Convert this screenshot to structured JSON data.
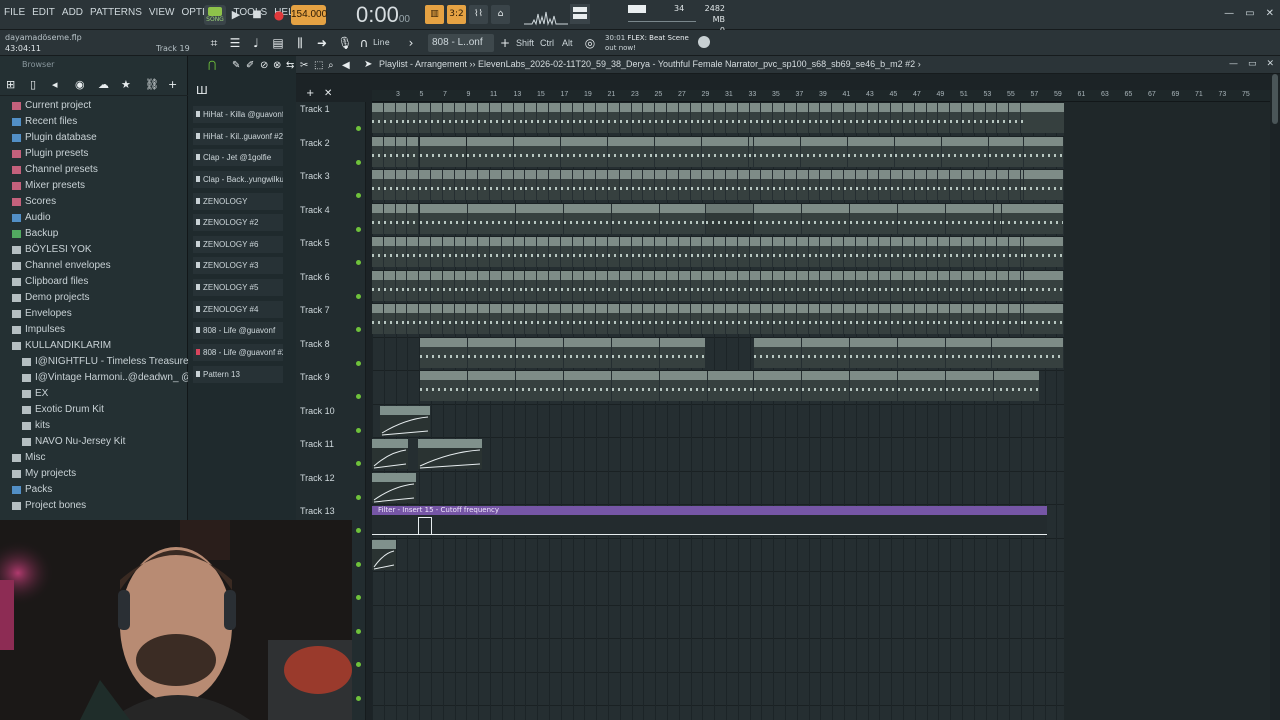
{
  "menu": [
    "FILE",
    "EDIT",
    "ADD",
    "PATTERNS",
    "VIEW",
    "OPTIONS",
    "TOOLS",
    "HELP"
  ],
  "transport": {
    "song_label": "SONG",
    "tempo": "154.000",
    "time": "0:00",
    "time_sub": "00"
  },
  "status": {
    "volume": "34",
    "memory": "2482 MB",
    "cpu": "0"
  },
  "info": {
    "project_name": "dayamadöseme.flp",
    "project_time": "43:04:11",
    "hint_track": "Track 19",
    "snap": "Line",
    "pattern": "808 - L..onf #2",
    "key_shift": "Shift",
    "key_ctrl": "Ctrl",
    "key_alt": "Alt",
    "news_time": "30:01",
    "news_title": "FLEX: Beat Scene",
    "news_sub": "out now!"
  },
  "browser": {
    "title": "Browser",
    "items": [
      {
        "label": "Current project",
        "color": "#e06a8a"
      },
      {
        "label": "Recent files",
        "color": "#5aa0e0"
      },
      {
        "label": "Plugin database",
        "color": "#5aa0e0"
      },
      {
        "label": "Plugin presets",
        "color": "#e06a8a"
      },
      {
        "label": "Channel presets",
        "color": "#e06a8a"
      },
      {
        "label": "Mixer presets",
        "color": "#e06a8a"
      },
      {
        "label": "Scores",
        "color": "#e06a8a"
      },
      {
        "label": "Audio",
        "color": "#5aa0e0"
      },
      {
        "label": "Backup",
        "color": "#5ac06a"
      },
      {
        "label": "BÖYLESI YOK",
        "color": "#cfd8dc"
      },
      {
        "label": "Channel envelopes",
        "color": "#cfd8dc"
      },
      {
        "label": "Clipboard files",
        "color": "#cfd8dc"
      },
      {
        "label": "Demo projects",
        "color": "#cfd8dc"
      },
      {
        "label": "Envelopes",
        "color": "#cfd8dc"
      },
      {
        "label": "Impulses",
        "color": "#cfd8dc"
      },
      {
        "label": "KULLANDIKLARIM",
        "color": "#cfd8dc"
      },
      {
        "label": "I@NIGHTFLU - Timeless Treasures",
        "color": "#cfd8dc",
        "indent": 1
      },
      {
        "label": "I@Vintage Harmoni..@deadwn_ @1mvnti",
        "color": "#cfd8dc",
        "indent": 1
      },
      {
        "label": "EX",
        "color": "#cfd8dc",
        "indent": 1
      },
      {
        "label": "Exotic Drum Kit",
        "color": "#cfd8dc",
        "indent": 1
      },
      {
        "label": "kits",
        "color": "#cfd8dc",
        "indent": 1
      },
      {
        "label": "NAVO Nu-Jersey Kit",
        "color": "#cfd8dc",
        "indent": 1
      },
      {
        "label": "Misc",
        "color": "#cfd8dc"
      },
      {
        "label": "My projects",
        "color": "#cfd8dc"
      },
      {
        "label": "Packs",
        "color": "#5aa0e0"
      },
      {
        "label": "Project bones",
        "color": "#cfd8dc"
      }
    ]
  },
  "channels": [
    "HiHat - Killa @guavonf",
    "HiHat - Kil..guavonf #2",
    "Clap - Jet @1golfie",
    "Clap - Back..yungwilku",
    "ZENOLOGY",
    "ZENOLOGY #2",
    "ZENOLOGY #6",
    "ZENOLOGY #3",
    "ZENOLOGY #5",
    "ZENOLOGY #4",
    "808 - Life @guavonf",
    "808 - Life @guavonf #2",
    "Pattern 13"
  ],
  "playlist": {
    "title": "Playlist - Arrangement",
    "file": "ElevenLabs_2026-02-11T20_59_38_Derya - Youthful Female Narrator_pvc_sp100_s68_sb69_se46_b_m2 #2",
    "ruler": [
      "3",
      "5",
      "7",
      "9",
      "11",
      "13",
      "15",
      "17",
      "19",
      "21",
      "23",
      "25",
      "27",
      "29",
      "31",
      "33",
      "35",
      "37",
      "39",
      "41",
      "43",
      "45",
      "47",
      "49",
      "51",
      "53",
      "55",
      "57",
      "59",
      "61",
      "63",
      "65",
      "67",
      "69",
      "71",
      "73",
      "75"
    ],
    "tracks": [
      "Track 1",
      "Track 2",
      "Track 3",
      "Track 4",
      "Track 5",
      "Track 6",
      "Track 7",
      "Track 8",
      "Track 9",
      "Track 10",
      "Track 11",
      "Track 12",
      "Track 13"
    ],
    "clip_labels": {
      "t1": "ZENOLOGY",
      "t2a": "ZENO..GY #6",
      "t2b": "ZEN..Y #2",
      "t3": "ZEN..Y #3",
      "t4a": "ZENO..GY #4",
      "t4b": "ZENO..GY #5",
      "t4c": "ZENOLOGY #5",
      "t5": "HiH..vonf",
      "t6": "Cla..olfie",
      "t7": "Clap..ilku",
      "t8a": "808 -..avonf",
      "t8b": "808 - ..nf #2",
      "t8c": "808 - Li..vonf #2",
      "t9": "Pattern 13",
      "t10": "..._LONG",
      "t11": "6..0_FX",
      "t12": "5..N_TURE"
    },
    "automation": "Filter - Insert 15 - Cutoff frequency"
  }
}
